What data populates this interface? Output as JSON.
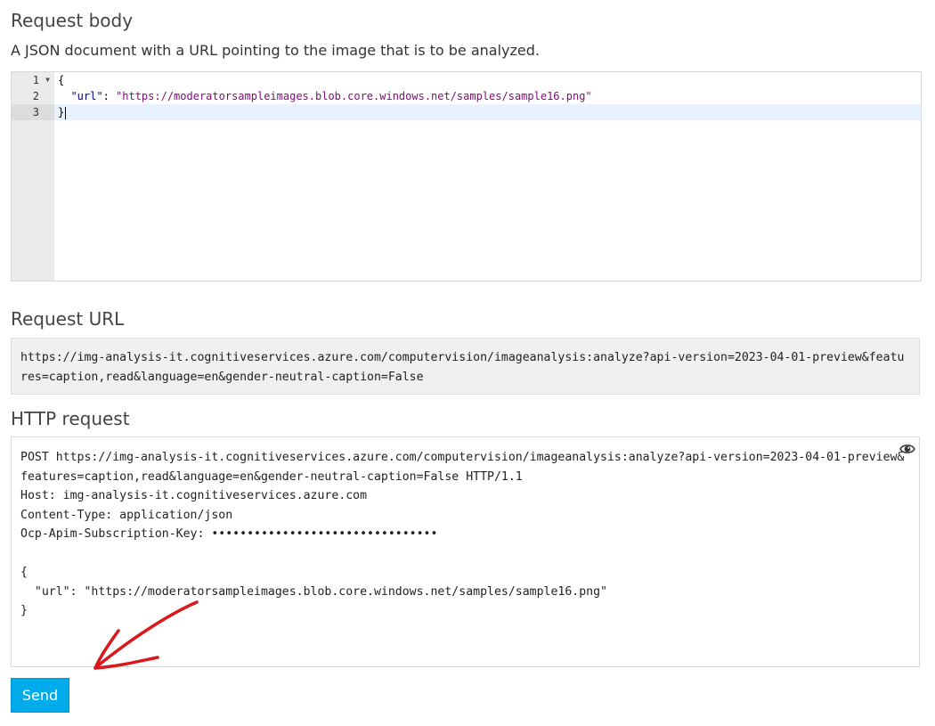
{
  "request_body": {
    "title": "Request body",
    "description": "A JSON document with a URL pointing to the image that is to be analyzed.",
    "lines": [
      {
        "number": "1",
        "open": "{"
      },
      {
        "number": "2",
        "key": "\"url\"",
        "sep": ": ",
        "value": "\"https://moderatorsampleimages.blob.core.windows.net/samples/sample16.png\""
      },
      {
        "number": "3",
        "close": "}"
      }
    ]
  },
  "request_url": {
    "title": "Request URL",
    "value": "https://img-analysis-it.cognitiveservices.azure.com/computervision/imageanalysis:analyze?api-version=2023-04-01-preview&features=caption,read&language=en&gender-neutral-caption=False"
  },
  "http_request": {
    "title": "HTTP request",
    "request_line": "POST https://img-analysis-it.cognitiveservices.azure.com/computervision/imageanalysis:analyze?api-version=2023-04-01-preview&features=caption,read&language=en&gender-neutral-caption=False HTTP/1.1",
    "host": "Host: img-analysis-it.cognitiveservices.azure.com",
    "content_type": "Content-Type: application/json",
    "subscription_key": "Ocp-Apim-Subscription-Key: ••••••••••••••••••••••••••••••••",
    "body_open": "{",
    "body_line": "  \"url\": \"https://moderatorsampleimages.blob.core.windows.net/samples/sample16.png\"",
    "body_close": "}"
  },
  "send_label": "Send",
  "icons": {
    "fold": "fold-arrow-icon",
    "reveal": "eye-icon",
    "annotation": "red-arrow-icon"
  },
  "colors": {
    "send_button": "#00abec",
    "annotation_arrow": "#d9191c",
    "string_token": "#7d0c75"
  }
}
